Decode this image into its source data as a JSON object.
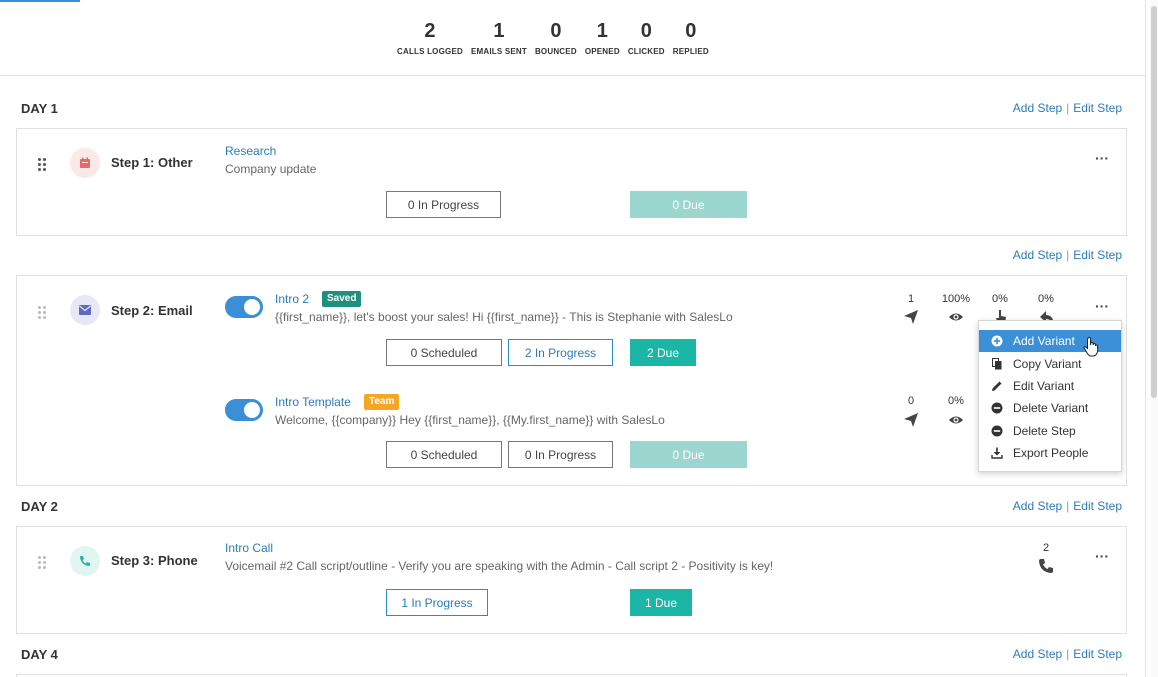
{
  "stats": [
    {
      "value": "2",
      "label": "CALLS LOGGED"
    },
    {
      "value": "1",
      "label": "EMAILS SENT"
    },
    {
      "value": "0",
      "label": "BOUNCED"
    },
    {
      "value": "1",
      "label": "OPENED"
    },
    {
      "value": "0",
      "label": "CLICKED"
    },
    {
      "value": "0",
      "label": "REPLIED"
    }
  ],
  "step_links": {
    "add_step": "Add Step",
    "edit_step": "Edit Step",
    "separator": "|"
  },
  "days": [
    {
      "label": "DAY 1"
    },
    {
      "label": "DAY 2"
    },
    {
      "label": "DAY 4"
    }
  ],
  "step1": {
    "title": "Step 1: Other",
    "template_name": "Research",
    "description": "Company update",
    "buttons": [
      "0 In Progress",
      "0 Due"
    ]
  },
  "step2": {
    "title": "Step 2: Email",
    "variants": [
      {
        "name": "Intro 2",
        "badge": "Saved",
        "preview": "{{first_name}}, let's boost your sales! Hi {{first_name}} - This is Stephanie with SalesLo",
        "metrics": [
          "1",
          "100%",
          "0%",
          "0%"
        ],
        "buttons": [
          "0 Scheduled",
          "2 In Progress",
          "2 Due"
        ]
      },
      {
        "name": "Intro Template",
        "badge": "Team",
        "preview": "Welcome, {{company}} Hey {{first_name}}, {{My.first_name}} with SalesLo",
        "metrics": [
          "0",
          "0%"
        ],
        "buttons": [
          "0 Scheduled",
          "0 In Progress",
          "0 Due"
        ]
      }
    ]
  },
  "step3": {
    "title": "Step 3: Phone",
    "template_name": "Intro Call",
    "description": "Voicemail #2 Call script/outline - Verify you are speaking with the Admin - Call script 2 - Positivity is key!",
    "metric": "2",
    "buttons": [
      "1 In Progress",
      "1 Due"
    ]
  },
  "more_label": "···",
  "dropdown": {
    "items": [
      {
        "label": "Add Variant",
        "icon": "plus-circle-icon",
        "active": true
      },
      {
        "label": "Copy Variant",
        "icon": "copy-icon"
      },
      {
        "label": "Edit Variant",
        "icon": "pencil-icon"
      },
      {
        "label": "Delete Variant",
        "icon": "minus-circle-icon"
      },
      {
        "label": "Delete Step",
        "icon": "minus-circle-icon"
      },
      {
        "label": "Export People",
        "icon": "download-icon"
      }
    ]
  },
  "colors": {
    "accent_blue": "#3a8fd6",
    "link_blue": "#2b7bb9",
    "teal": "#1bb6a6",
    "teal_light": "#9bd6cf",
    "badge_saved": "#1f8f7e",
    "badge_team": "#f5a623"
  }
}
